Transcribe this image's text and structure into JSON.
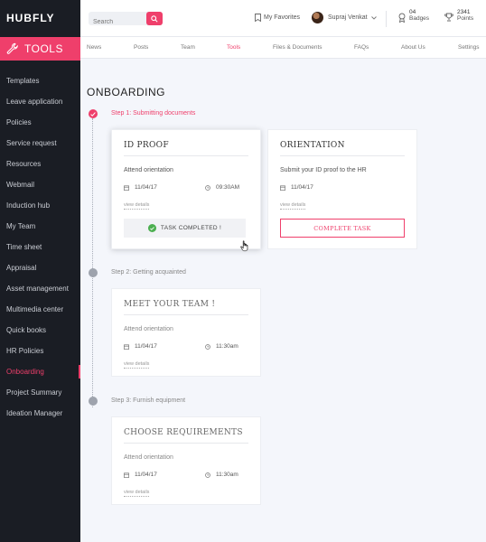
{
  "app": {
    "brand": "HUBFLY",
    "section": "TOOLS"
  },
  "colors": {
    "accent": "#ef3f6b",
    "sidebar": "#1a1d24",
    "success": "#4caf50"
  },
  "sidebar": {
    "items": [
      {
        "label": "Templates"
      },
      {
        "label": "Leave application"
      },
      {
        "label": "Policies"
      },
      {
        "label": "Service request"
      },
      {
        "label": "Resources"
      },
      {
        "label": "Webmail"
      },
      {
        "label": "Induction hub"
      },
      {
        "label": "My Team"
      },
      {
        "label": "Time sheet"
      },
      {
        "label": "Appraisal"
      },
      {
        "label": "Asset management"
      },
      {
        "label": "Multimedia center"
      },
      {
        "label": "Quick books"
      },
      {
        "label": "HR Policies"
      },
      {
        "label": "Onboarding",
        "active": true
      },
      {
        "label": "Project Summary"
      },
      {
        "label": "Ideation Manager"
      }
    ]
  },
  "header": {
    "search_placeholder": "Search",
    "favorites_label": "My Favorites",
    "user_name": "Supraj Venkat",
    "badges_count": "04",
    "badges_label": "Badges",
    "points_count": "2341",
    "points_label": "Points"
  },
  "nav": {
    "tabs": [
      {
        "label": "News"
      },
      {
        "label": "Posts"
      },
      {
        "label": "Team"
      },
      {
        "label": "Tools",
        "active": true
      },
      {
        "label": "Files & Documents"
      },
      {
        "label": "FAQs"
      },
      {
        "label": "About Us"
      },
      {
        "label": "Settings"
      }
    ]
  },
  "main": {
    "title": "ONBOARDING",
    "steps": [
      {
        "label": "Step 1: Submitting documents",
        "status": "done"
      },
      {
        "label": "Step 2: Getting acquainted",
        "status": "pending"
      },
      {
        "label": "Step 3: Furnish equipment",
        "status": "pending"
      }
    ],
    "cards": {
      "id_proof": {
        "title": "ID PROOF",
        "desc": "Attend orientation",
        "date": "11/04/17",
        "time": "09:30AM",
        "link": "view details",
        "status": "TASK COMPLETED !"
      },
      "orientation": {
        "title": "ORIENTATION",
        "desc": "Submit your ID proof to the HR",
        "date": "11/04/17",
        "link": "view details",
        "action": "COMPLETE TASK"
      },
      "meet_team": {
        "title": "MEET YOUR TEAM !",
        "desc": "Attend orientation",
        "date": "11/04/17",
        "time": "11:30am",
        "link": "view details"
      },
      "requirements": {
        "title": "CHOOSE REQUIREMENTS",
        "desc": "Attend orientation",
        "date": "11/04/17",
        "time": "11:30am",
        "link": "view details"
      }
    }
  }
}
